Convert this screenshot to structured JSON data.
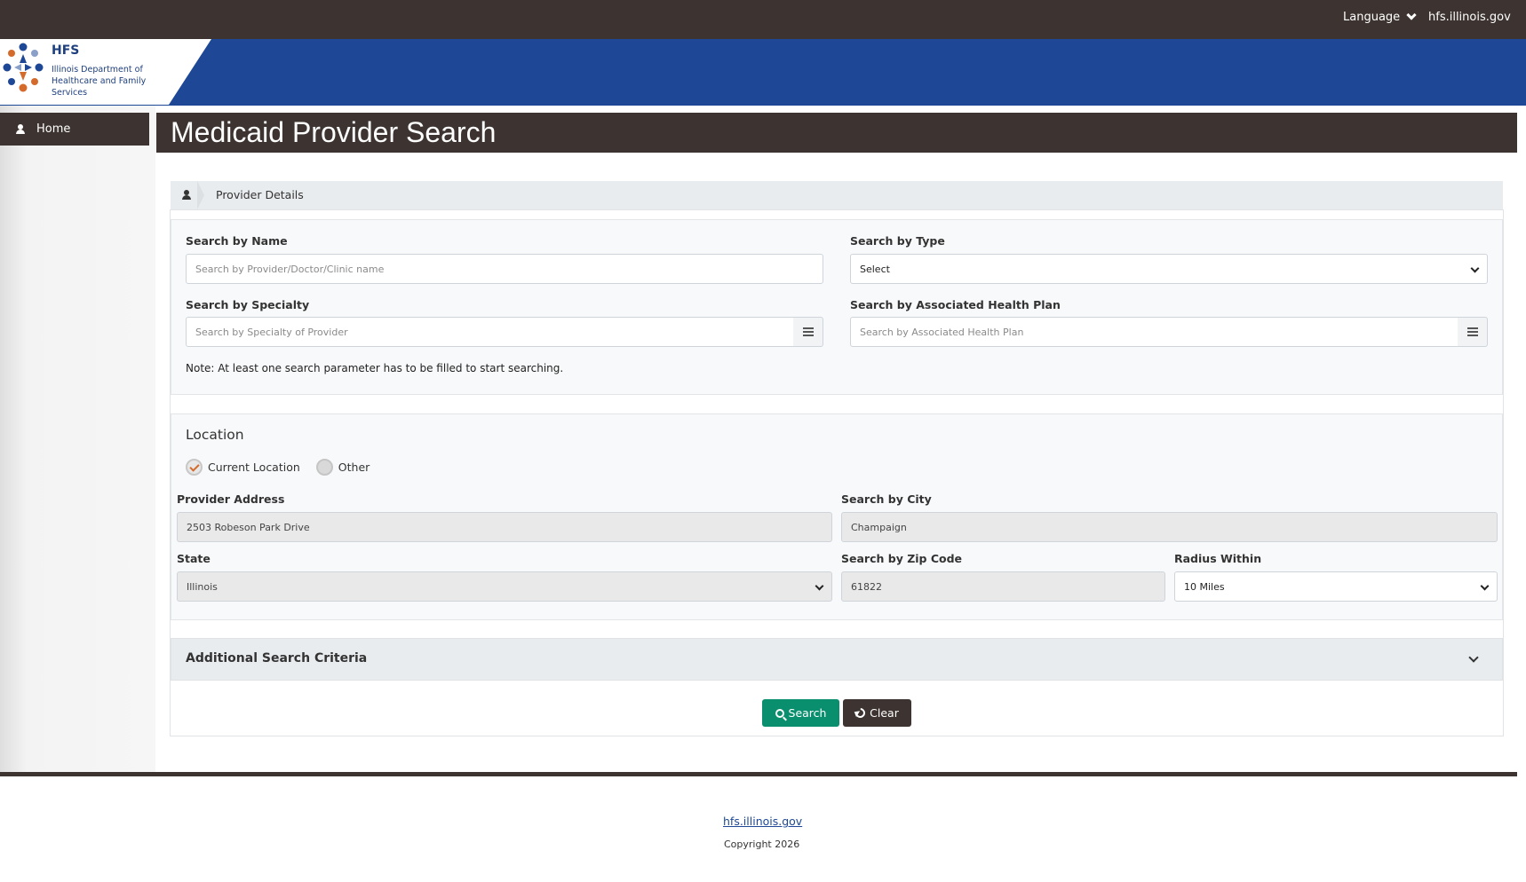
{
  "topbar": {
    "language_label": "Language",
    "site_link": "hfs.illinois.gov"
  },
  "logo": {
    "abbr": "HFS",
    "dept_line1": "Illinois Department of",
    "dept_line2": "Healthcare and Family Services"
  },
  "sidebar": {
    "items": [
      {
        "label": "Home",
        "icon": "home-icon"
      }
    ]
  },
  "page": {
    "title": "Medicaid Provider Search"
  },
  "breadcrumb": {
    "current": "Provider Details"
  },
  "search": {
    "name_label": "Search by Name",
    "name_placeholder": "Search by Provider/Doctor/Clinic name",
    "type_label": "Search by Type",
    "type_selected": "Select",
    "specialty_label": "Search by Specialty",
    "specialty_placeholder": "Search by Specialty of Provider",
    "plan_label": "Search by Associated Health Plan",
    "plan_placeholder": "Search by Associated Health Plan",
    "note": "Note: At least one search parameter has to be filled to start searching."
  },
  "location": {
    "title": "Location",
    "option_current": "Current Location",
    "option_other": "Other",
    "address_label": "Provider Address",
    "address_value": "2503 Robeson Park Drive",
    "city_label": "Search by City",
    "city_value": "Champaign",
    "state_label": "State",
    "state_value": "Illinois",
    "zip_label": "Search by Zip Code",
    "zip_value": "61822",
    "radius_label": "Radius Within",
    "radius_value": "10 Miles"
  },
  "additional": {
    "title": "Additional Search Criteria"
  },
  "actions": {
    "search_label": "Search",
    "clear_label": "Clear"
  },
  "footer": {
    "link": "hfs.illinois.gov",
    "copyright": "Copyright 2026"
  },
  "colors": {
    "dark_brown": "#3d3431",
    "brand_blue": "#1e4896",
    "search_green": "#0a8f6e",
    "radio_check_orange": "#d46b2c"
  }
}
